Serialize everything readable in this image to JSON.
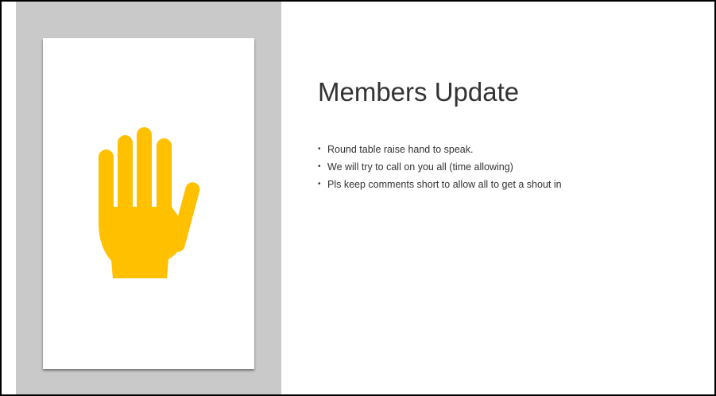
{
  "slide": {
    "title": "Members Update",
    "bullet_char": "•",
    "bullets": [
      "Round table raise hand to speak.",
      "We will try to call on you all (time allowing)",
      "Pls keep comments short to allow all to get a shout in"
    ]
  },
  "picture": {
    "icon": "raised-hand-icon",
    "icon_color": "#ffc000"
  },
  "colors": {
    "band": "#c9c9c9",
    "text": "#333333",
    "border": "#000000"
  }
}
